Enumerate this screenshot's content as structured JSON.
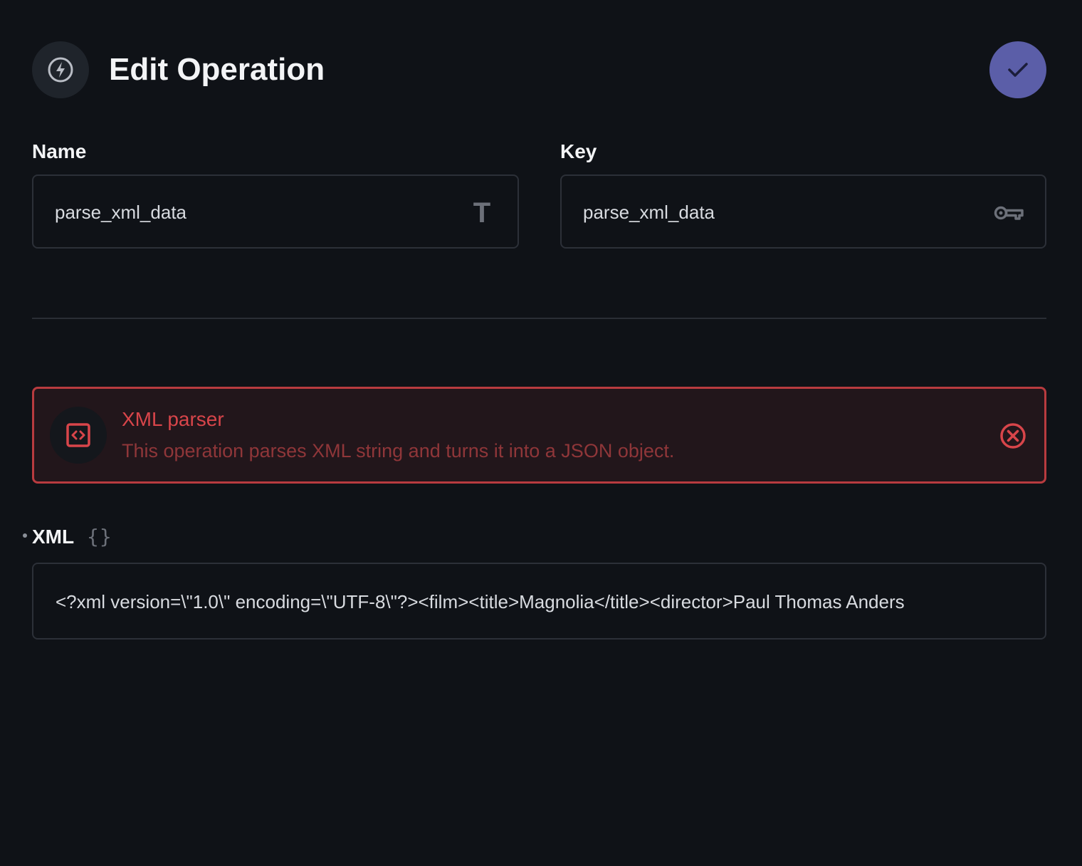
{
  "header": {
    "title": "Edit Operation",
    "icon": "bolt-icon",
    "save_icon": "check-icon",
    "accent_color": "#5b5ea8"
  },
  "fields": {
    "name": {
      "label": "Name",
      "value": "parse_xml_data",
      "icon": "text-type-icon",
      "icon_glyph": "T"
    },
    "key": {
      "label": "Key",
      "value": "parse_xml_data",
      "icon": "key-icon"
    }
  },
  "notice": {
    "title": "XML parser",
    "description": "This operation parses XML string and turns it into a JSON object.",
    "icon": "code-brackets-icon",
    "close_icon": "close-circle-icon",
    "color": "#d8454a"
  },
  "xml_field": {
    "label": "XML",
    "icon": "braces-icon",
    "icon_glyph": "{}",
    "value": "<?xml version=\\\"1.0\\\" encoding=\\\"UTF-8\\\"?><film><title>Magnolia</title><director>Paul Thomas Anders"
  }
}
